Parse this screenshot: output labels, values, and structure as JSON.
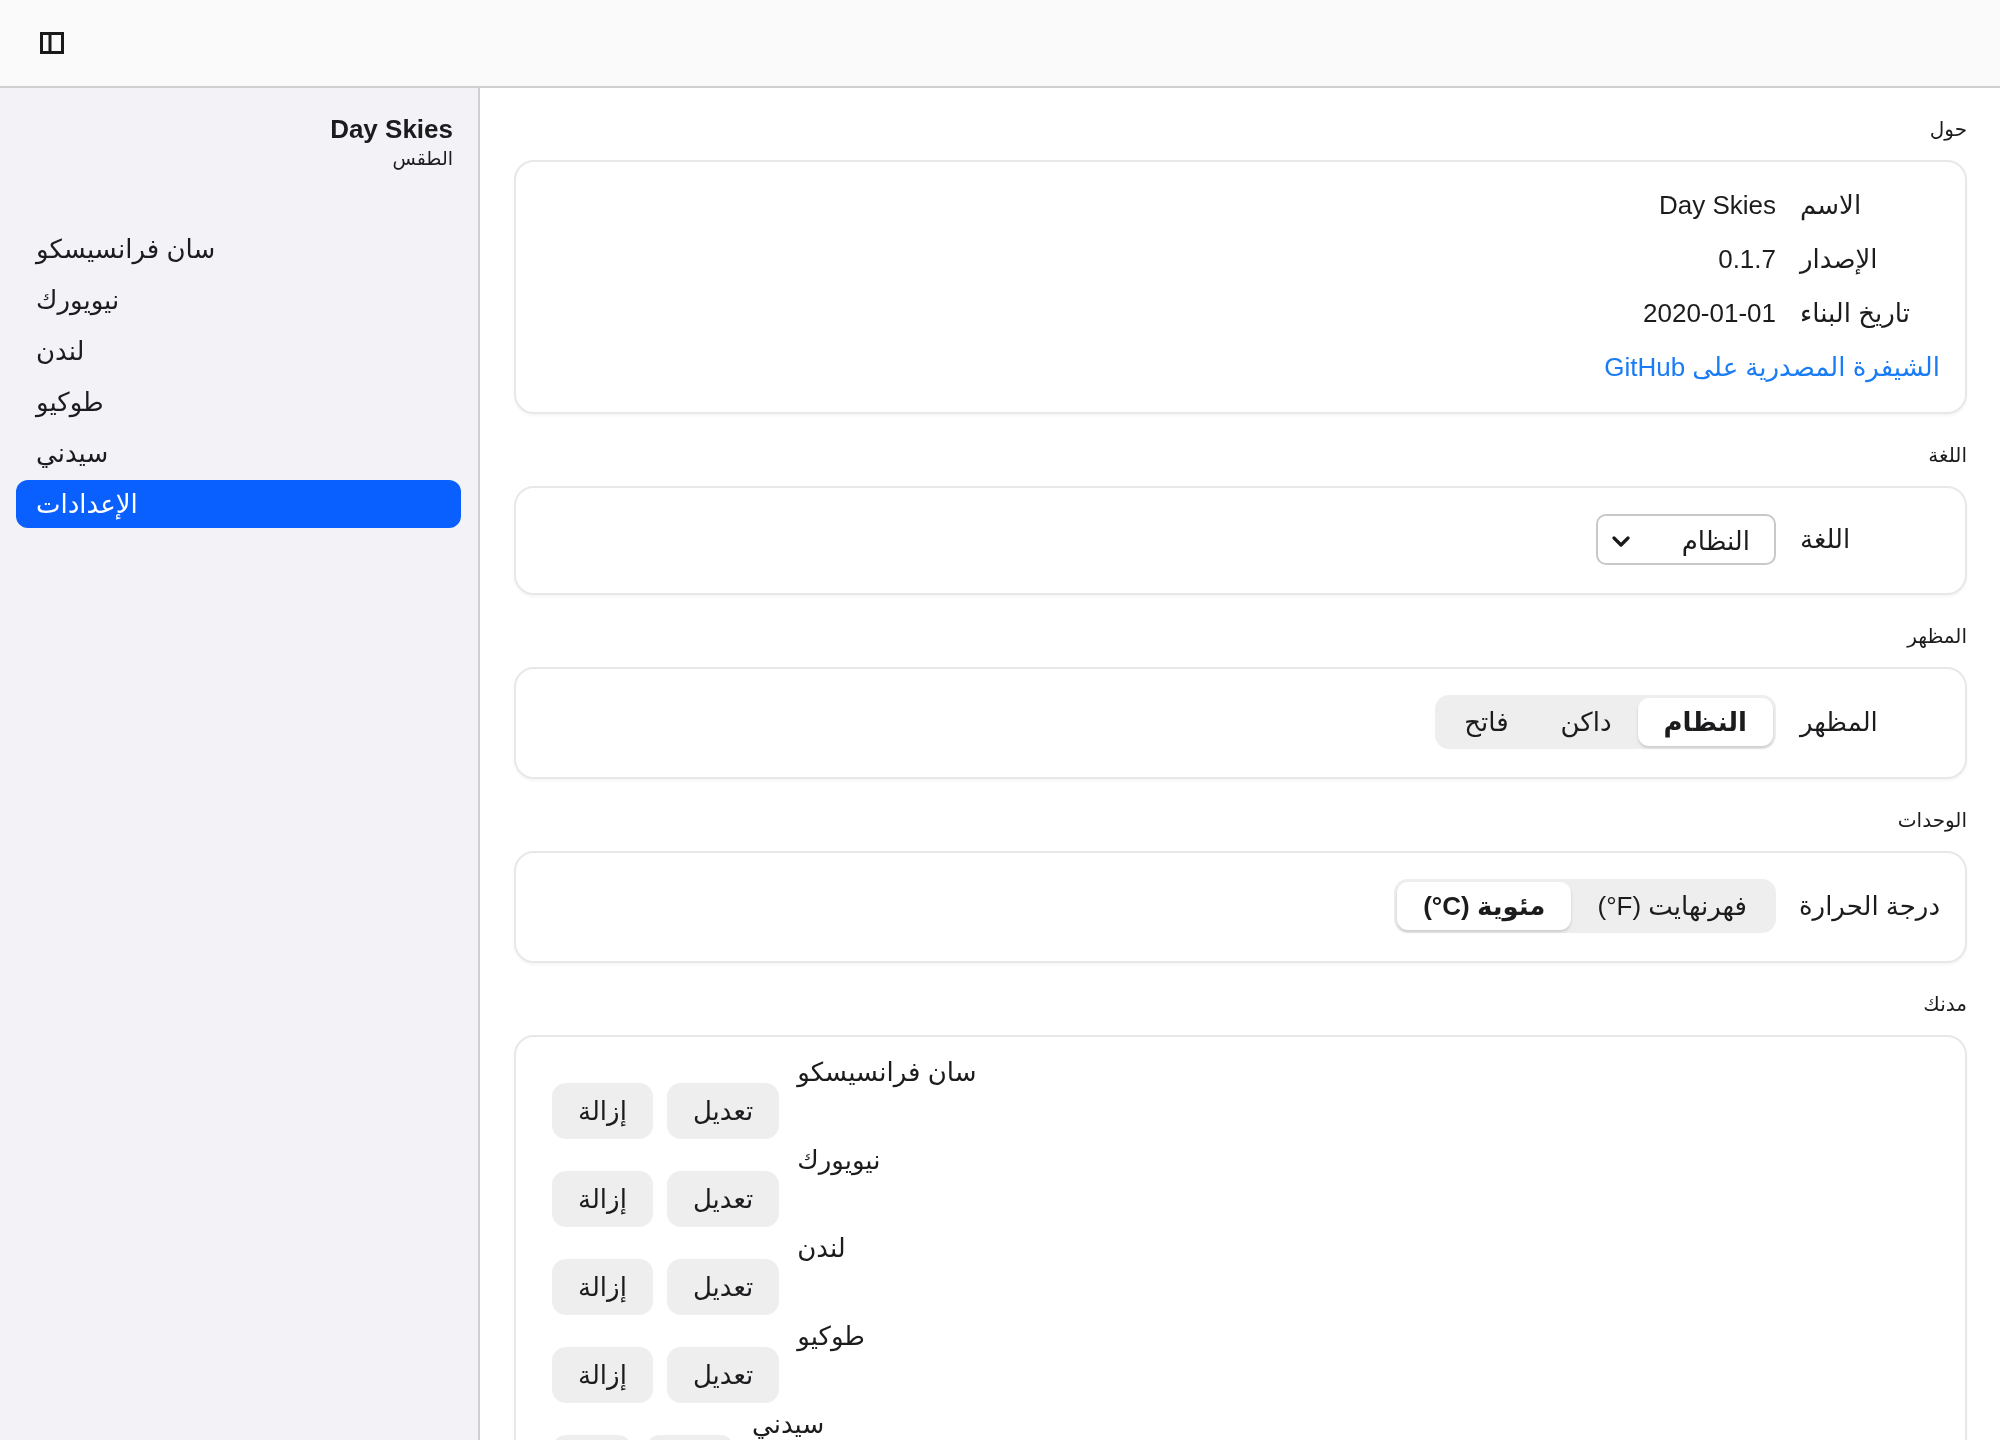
{
  "sidebar": {
    "title": "Day Skies",
    "subtitle": "الطقس",
    "items": [
      {
        "label": "سان فرانسيسكو",
        "selected": false
      },
      {
        "label": "نيويورك",
        "selected": false
      },
      {
        "label": "لندن",
        "selected": false
      },
      {
        "label": "طوكيو",
        "selected": false
      },
      {
        "label": "سيدني",
        "selected": false
      },
      {
        "label": "الإعدادات",
        "selected": true
      }
    ]
  },
  "sections": [
    {
      "kind": "about",
      "heading": "حول",
      "rows": [
        {
          "label": "الاسم",
          "value": "Day Skies"
        },
        {
          "label": "الإصدار",
          "value": "0.1.7"
        },
        {
          "label": "تاريخ البناء",
          "value": "2020-01-01"
        }
      ],
      "link": "الشيفرة المصدرية على GitHub"
    },
    {
      "kind": "select",
      "heading": "اللغة",
      "label": "اللغة",
      "value": "النظام"
    },
    {
      "kind": "segmented",
      "heading": "المظهر",
      "label": "المظهر",
      "options": [
        {
          "label": "النظام",
          "selected": true
        },
        {
          "label": "داكن",
          "selected": false
        },
        {
          "label": "فاتح",
          "selected": false
        }
      ]
    },
    {
      "kind": "segmented",
      "heading": "الوحدات",
      "label": "درجة الحرارة",
      "options": [
        {
          "label": "فهرنهايت (‎°F)",
          "selected": false
        },
        {
          "label": "مئوية (‎°C)",
          "selected": true
        }
      ]
    },
    {
      "kind": "locations",
      "heading": "مدنك",
      "rows": [
        {
          "name": "سان فرانسيسكو",
          "edit": "تعديل",
          "remove": "إزالة"
        },
        {
          "name": "نيويورك",
          "edit": "تعديل",
          "remove": "إزالة"
        },
        {
          "name": "لندن",
          "edit": "تعديل",
          "remove": "إزالة"
        },
        {
          "name": "طوكيو",
          "edit": "تعديل",
          "remove": "إزالة"
        },
        {
          "name": "سيدني"
        }
      ]
    }
  ]
}
